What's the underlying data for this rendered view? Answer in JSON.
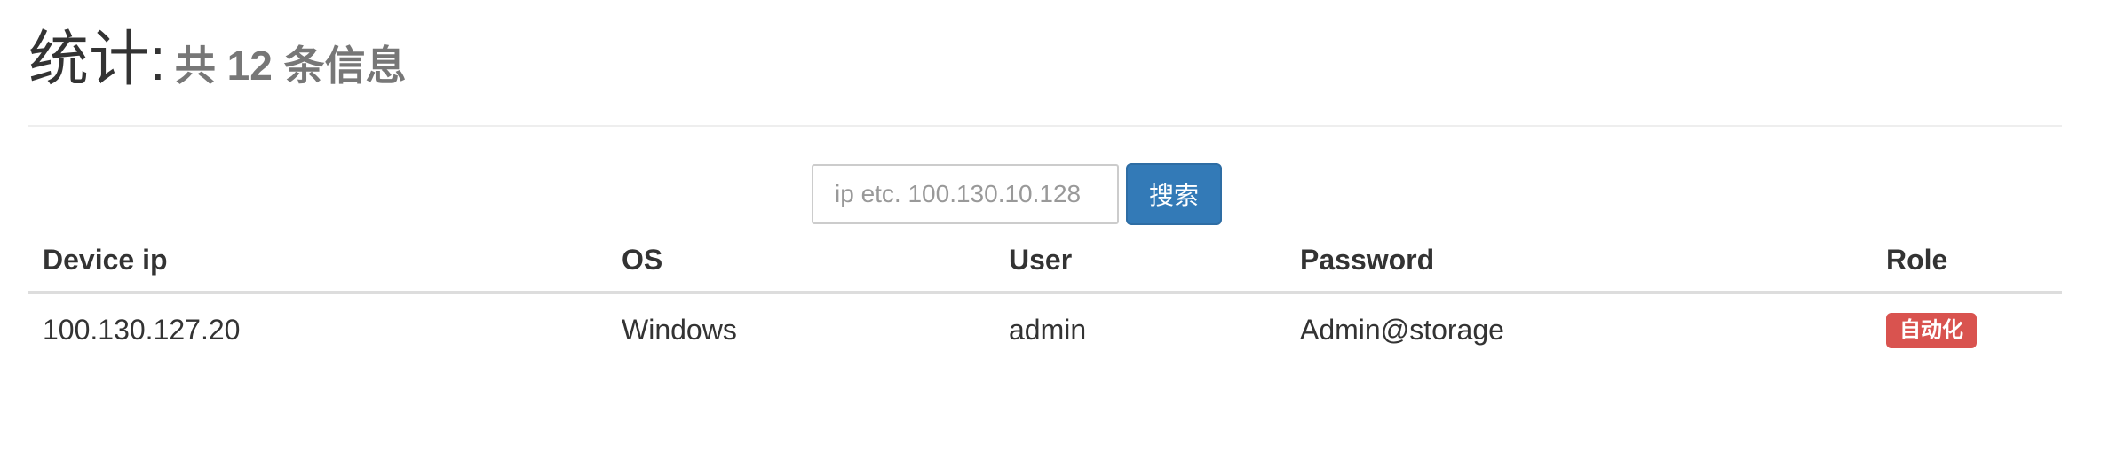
{
  "header": {
    "title": "统计:",
    "subtitle": "共 12 条信息"
  },
  "search": {
    "placeholder": "ip etc. 100.130.10.128",
    "value": "",
    "button_label": "搜索"
  },
  "table": {
    "columns": [
      "Device ip",
      "OS",
      "User",
      "Password",
      "Role"
    ],
    "rows": [
      {
        "device_ip": "100.130.127.20",
        "os": "Windows",
        "user": "admin",
        "password": "Admin@storage",
        "role": "自动化"
      }
    ]
  },
  "colors": {
    "primary_button": "#337ab7",
    "role_badge": "#d9534f"
  }
}
